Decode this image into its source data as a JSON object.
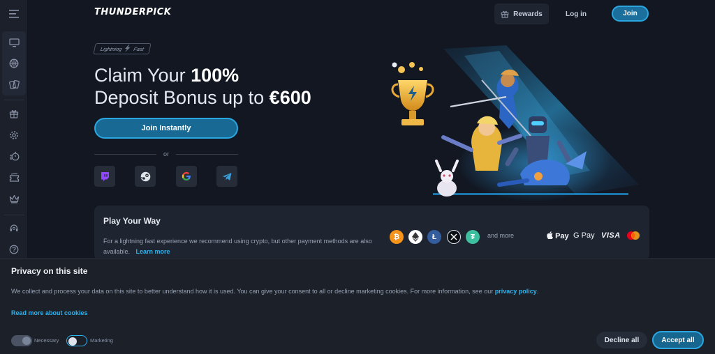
{
  "header": {
    "logo": "THUNDERPICK",
    "rewards_label": "Rewards",
    "login_label": "Log in",
    "join_label": "Join"
  },
  "sidebar": {
    "items": [
      {
        "icon": "menu-icon"
      },
      {
        "icon": "monitor-icon"
      },
      {
        "icon": "basketball-icon"
      },
      {
        "icon": "cards-icon"
      },
      {
        "icon": "gift-icon"
      },
      {
        "icon": "gear-icon"
      },
      {
        "icon": "stopwatch-icon"
      },
      {
        "icon": "ticket-icon"
      },
      {
        "icon": "crown-icon"
      },
      {
        "icon": "support-icon"
      },
      {
        "icon": "help-icon"
      }
    ]
  },
  "hero": {
    "tag_left": "Lightning",
    "tag_right": "Fast",
    "headline_line1_a": "Claim Your ",
    "headline_line1_b": "100%",
    "headline_line2_a": "Deposit Bonus up to ",
    "headline_line2_b": "€600",
    "join_button": "Join Instantly",
    "or_label": "or",
    "social": [
      "twitch-icon",
      "steam-icon",
      "google-icon",
      "telegram-icon"
    ]
  },
  "payments": {
    "title": "Play Your Way",
    "text": "For a lightning fast experience we recommend using crypto, but other payment methods are also available.",
    "learn_more": "Learn more",
    "and_more": "and more",
    "apple_pay": "Pay",
    "google_pay": "G Pay",
    "visa": "VISA",
    "coins": [
      "bitcoin-icon",
      "ethereum-icon",
      "litecoin-icon",
      "xrp-icon",
      "tether-icon"
    ]
  },
  "cookie": {
    "title": "Privacy on this site",
    "text": "We collect and process your data on this site to better understand how it is used. You can give your consent to all or decline marketing cookies. For more information, see our ",
    "policy_link": "privacy policy",
    "text_end": ".",
    "read_more": "Read more about cookies",
    "necessary_label": "Necessary",
    "marketing_label": "Marketing",
    "decline_label": "Decline all",
    "accept_label": "Accept all"
  },
  "colors": {
    "accent": "#2ab4f0",
    "button_fill": "#186a95",
    "background": "#121722"
  }
}
